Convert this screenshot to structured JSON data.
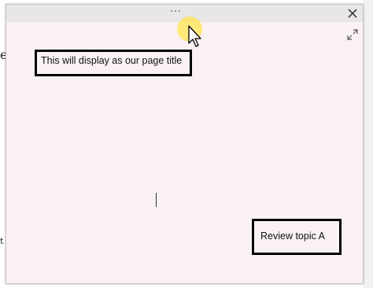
{
  "window": {
    "close_label": "✕",
    "expand_icon": "expand-icon",
    "drag_icon": "drag-handle-icon"
  },
  "content": {
    "title_box_text": "This will display as our page title",
    "review_box_text": "Review topic A"
  },
  "background": {
    "fragment_1": "e",
    "fragment_2": "t"
  },
  "colors": {
    "window_bg": "#faf1f3",
    "titlebar_bg": "#e9e6e8",
    "cursor_highlight": "#ffe450"
  }
}
